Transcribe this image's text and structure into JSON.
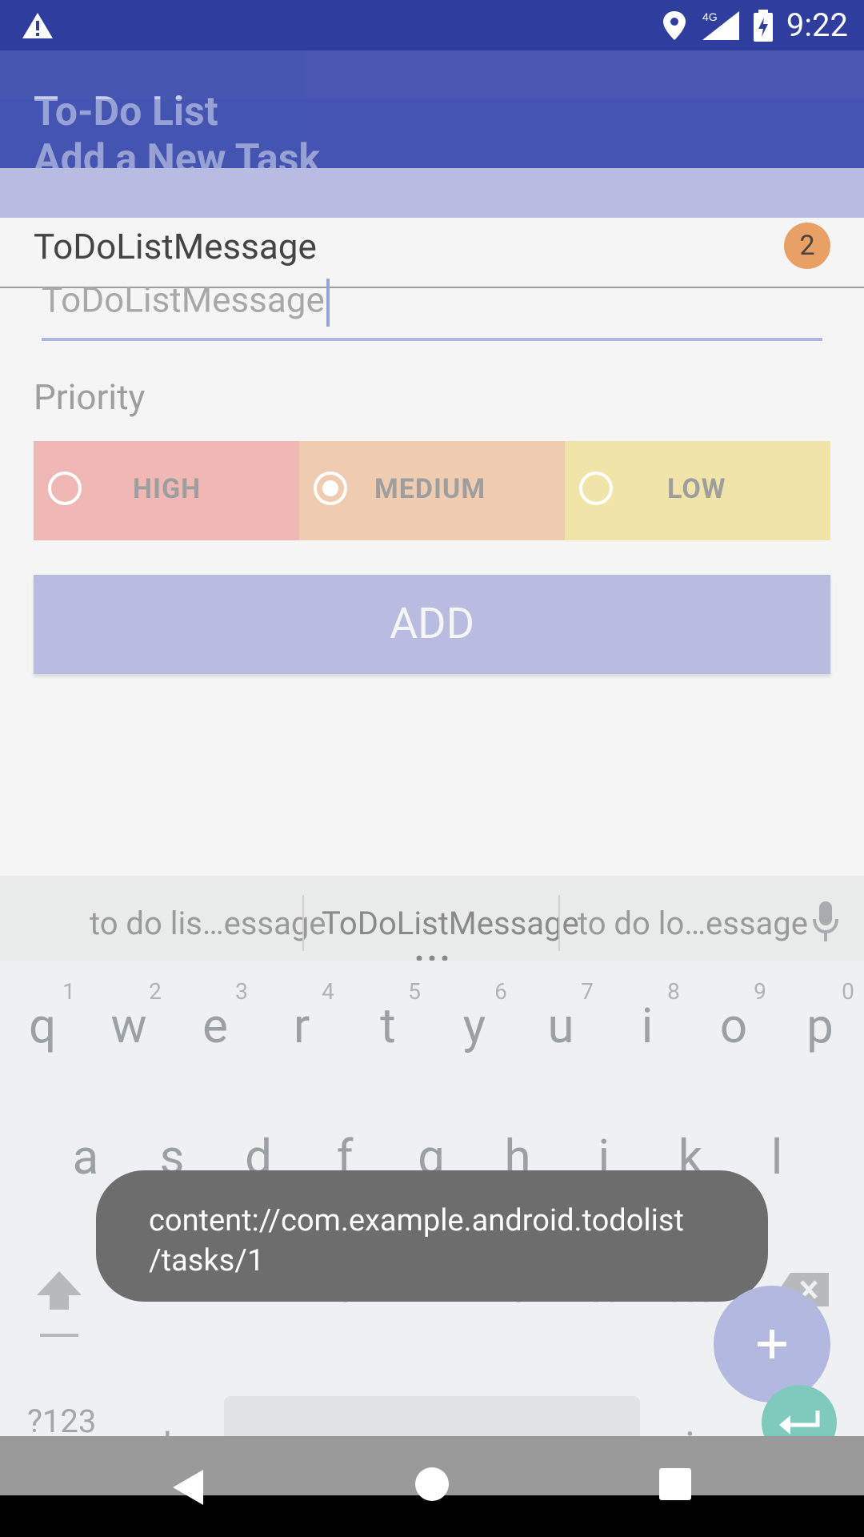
{
  "status_bar": {
    "time": "9:22",
    "network": "4G"
  },
  "toolbar": {
    "title_main": "To-Do List",
    "title_add": "Add a New Task"
  },
  "task_list": {
    "items": [
      {
        "description": "ToDoListMessage",
        "priority": "2"
      }
    ]
  },
  "form": {
    "input_value": "ToDoListMessage",
    "priority_label": "Priority",
    "options": [
      {
        "label": "HIGH",
        "checked": false
      },
      {
        "label": "MEDIUM",
        "checked": true
      },
      {
        "label": "LOW",
        "checked": false
      }
    ],
    "add_label": "ADD"
  },
  "keyboard": {
    "suggestions": [
      "to do lis…essage",
      "ToDoListMessage",
      "to do lo…essage"
    ],
    "row1": [
      "q",
      "w",
      "e",
      "r",
      "t",
      "y",
      "u",
      "i",
      "o",
      "p"
    ],
    "row1_hints": [
      "1",
      "2",
      "3",
      "4",
      "5",
      "6",
      "7",
      "8",
      "9",
      "0"
    ],
    "row2": [
      "a",
      "s",
      "d",
      "f",
      "g",
      "h",
      "j",
      "k",
      "l"
    ],
    "row3": [
      "z",
      "x",
      "c",
      "v",
      "b",
      "n",
      "m"
    ],
    "symbols_label": "?123",
    "comma": ",",
    "period": "."
  },
  "toast": {
    "message": "content://com.example.android.todolist\n/tasks/1"
  },
  "colors": {
    "primary": "#3f51b5",
    "primary_dark": "#303f9f",
    "high": "#efb8b4",
    "medium": "#efcbb0",
    "low": "#f1e4a8"
  }
}
